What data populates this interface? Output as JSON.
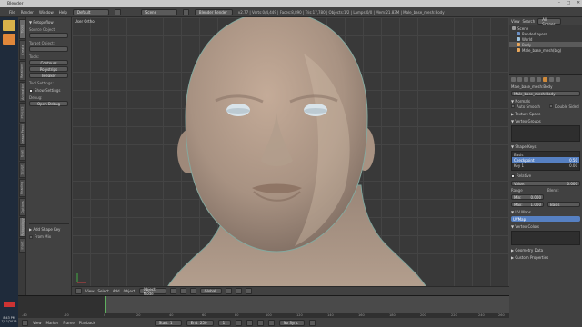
{
  "window": {
    "title": "Blender"
  },
  "info_header": {
    "menus": [
      "File",
      "Render",
      "Window",
      "Help"
    ],
    "layout": "Default",
    "scene": "Scene",
    "engine": "Blender Render",
    "stats": "v2.77 | Verts:0/4,449 | Faces:8,890 | Tris:17,780 | Objects:1/2 | Lamps:0/0 | Mem:21.83M | Male_base_mesh:Body"
  },
  "tool_tabs": [
    "Tools",
    "Create",
    "Relations",
    "Animation",
    "Physics",
    "Grease Pencil",
    "Grab",
    "Sculpt",
    "Shading",
    "Options",
    "Retopology",
    "Inout"
  ],
  "tool_shelf": {
    "header": "▼ Retopoflow",
    "source_label": "Source Object:",
    "target_label": "Target Object:",
    "tools_label": "Tools:",
    "tools": [
      "Contours",
      "Polystrips",
      "Tweaker"
    ],
    "settings_label": "Tool Settings:",
    "show_settings": "Show Settings",
    "debug_label": "Debug:",
    "debug_button": "Open Debug",
    "operator_header": "▶ Add Shape Key",
    "from_mix": "From Mix"
  },
  "viewport": {
    "title": "User Ortho",
    "object_label": "(1) Male_base_mesh:Body : Key 1",
    "header": {
      "menus": [
        "View",
        "Select",
        "Add",
        "Object"
      ],
      "mode": "Object Mode",
      "pivot": "Global"
    }
  },
  "timeline": {
    "ticks": [
      "-40",
      "-20",
      "0",
      "20",
      "40",
      "60",
      "80",
      "100",
      "120",
      "140",
      "160",
      "180",
      "200",
      "220",
      "240",
      "260"
    ],
    "header": {
      "menus": [
        "View",
        "Marker",
        "Frame",
        "Playback"
      ],
      "start_label": "Start: 1",
      "end_label": "End: 250",
      "current": "1",
      "sync": "No Sync"
    }
  },
  "outliner": {
    "header_menus": [
      "View",
      "Search",
      "All Scenes"
    ],
    "items": [
      {
        "label": "Scene",
        "indent": 0,
        "selected": false
      },
      {
        "label": "RenderLayers",
        "indent": 1,
        "selected": false
      },
      {
        "label": "World",
        "indent": 1,
        "selected": false
      },
      {
        "label": "Body",
        "indent": 1,
        "selected": true
      },
      {
        "label": "Male_base_mesh(big)",
        "indent": 1,
        "selected": false
      }
    ]
  },
  "properties": {
    "breadcrumb": "Male_base_mesh:Body",
    "mesh_name": "Male_base_mesh:Body",
    "normals_header": "▼ Normals",
    "auto_smooth": "Auto Smooth",
    "double_sided": "Double Sided",
    "texture_space": "▶ Texture Space",
    "vertex_groups": "▼ Vertex Groups",
    "shape_keys_header": "▼ Shape Keys",
    "shape_keys": [
      {
        "name": "Basis",
        "value": ""
      },
      {
        "name": "Checkpoint",
        "value": "0.50"
      },
      {
        "name": "Key 1",
        "value": "0.00"
      }
    ],
    "relative": "Relative",
    "value_label": "Value:",
    "value": "0.000",
    "range_label": "Range",
    "min_label": "Min:",
    "min_value": "0.000",
    "max_label": "Max:",
    "max_value": "1.000",
    "blend_label": "Blend:",
    "relative_key": "Basis",
    "uv_maps_header": "▼ UV Maps",
    "uv_map": "UVMap",
    "vertex_colors_header": "▼ Vertex Colors",
    "geometry_data": "▶ Geometry Data",
    "custom_properties": "▶ Custom Properties"
  },
  "clock": {
    "time": "8:43 PM",
    "date": "7/11/2016"
  }
}
